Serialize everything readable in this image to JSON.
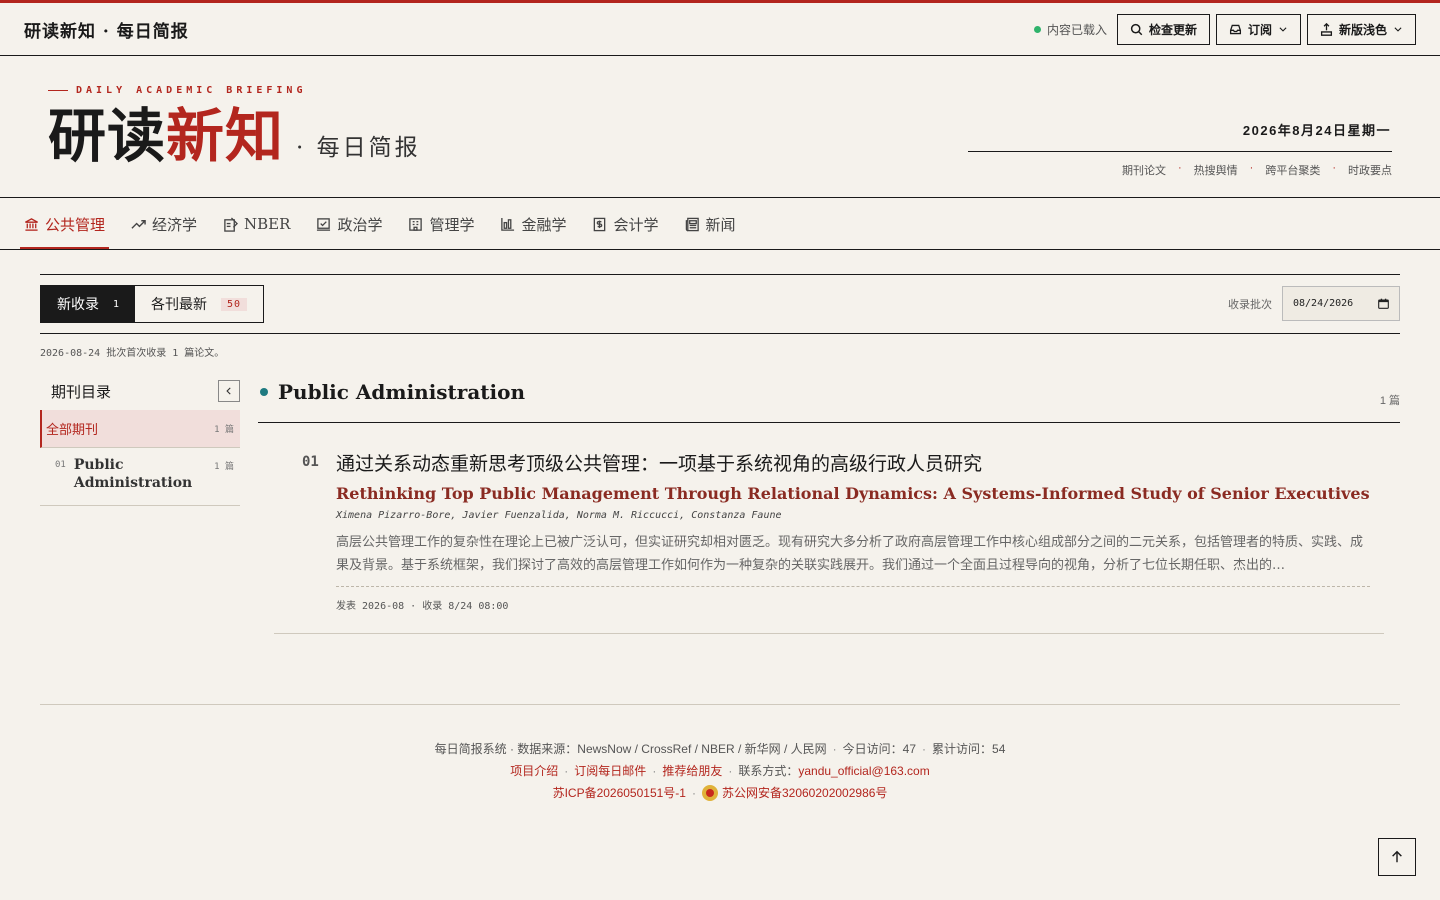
{
  "header": {
    "site_title": "研读新知 · 每日简报",
    "status": "内容已载入",
    "check_update": "检查更新",
    "subscribe": "订阅",
    "theme": "新版浅色"
  },
  "masthead": {
    "kicker": "DAILY ACADEMIC BRIEFING",
    "brand_part1": "研读",
    "brand_part2": "新知",
    "brand_sub": "· 每日简报",
    "date": "2026年8月24日星期一",
    "sections": [
      "期刊论文",
      "热搜舆情",
      "跨平台聚类",
      "时政要点"
    ]
  },
  "nav": {
    "items": [
      {
        "label": "公共管理",
        "icon": "bank-icon"
      },
      {
        "label": "经济学",
        "icon": "trend-icon"
      },
      {
        "label": "NBER",
        "icon": "note-icon"
      },
      {
        "label": "政治学",
        "icon": "vote-icon"
      },
      {
        "label": "管理学",
        "icon": "building-icon"
      },
      {
        "label": "金融学",
        "icon": "bar-chart-icon"
      },
      {
        "label": "会计学",
        "icon": "dollar-doc-icon"
      },
      {
        "label": "新闻",
        "icon": "newspaper-icon"
      }
    ]
  },
  "tabs": {
    "new_label": "新收录",
    "new_count": "1",
    "latest_label": "各刊最新",
    "latest_count": "50"
  },
  "batch": {
    "label": "收录批次",
    "value": "08/24/2026"
  },
  "batch_note": "2026-08-24 批次首次收录 1 篇论文。",
  "sidebar": {
    "title": "期刊目录",
    "all_label": "全部期刊",
    "all_count": "1 篇",
    "journals": [
      {
        "num": "01",
        "name": "Public Administration",
        "count": "1 篇"
      }
    ]
  },
  "main": {
    "journal_title": "Public Administration",
    "journal_count": "1 篇",
    "articles": [
      {
        "num": "01",
        "title_zh": "通过关系动态重新思考顶级公共管理：一项基于系统视角的高级行政人员研究",
        "title_en": "Rethinking Top Public Management Through Relational Dynamics: A Systems-Informed Study of Senior Executives",
        "authors": "Ximena Pizarro-Bore, Javier Fuenzalida, Norma M. Riccucci, Constanza Faune",
        "abstract": "高层公共管理工作的复杂性在理论上已被广泛认可，但实证研究却相对匮乏。现有研究大多分析了政府高层管理工作中核心组成部分之间的二元关系，包括管理者的特质、实践、成果及背景。基于系统框架，我们探讨了高效的高层管理工作如何作为一种复杂的关联实践展开。我们通过一个全面且过程导向的视角，分析了七位长期任职、杰出的…",
        "meta": "发表 2026-08 · 收录 8/24 08:00"
      }
    ]
  },
  "footer": {
    "line1_a": "每日简报系统 · 数据来源：NewsNow / CrossRef / NBER / 新华网 / 人民网",
    "line1_b": "今日访问：47",
    "line1_c": "累计访问：54",
    "intro": "项目介绍",
    "subscribe_mail": "订阅每日邮件",
    "recommend": "推荐给朋友",
    "contact_label": "联系方式：",
    "contact_email": "yandu_official@163.com",
    "icp": "苏ICP备2026050151号-1",
    "police": "苏公网安备32060202002986号"
  },
  "colors": {
    "accent": "#b3261e",
    "background": "#f5f2ec",
    "ink": "#1a1a1a",
    "status_dot": "#2fb36b",
    "journal_dot": "#1e7a80"
  }
}
